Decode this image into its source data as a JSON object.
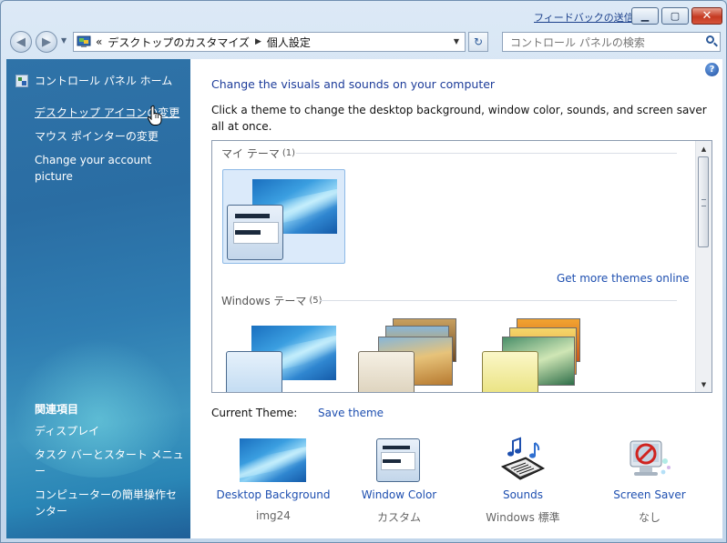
{
  "window": {
    "feedback_link": "フィードバックの送信",
    "controls": {
      "minimize_icon": "minimize-icon",
      "maximize_icon": "maximize-icon",
      "close_icon": "close-icon"
    }
  },
  "nav": {
    "breadcrumb_prefix": "«",
    "breadcrumb": [
      "デスクトップのカスタマイズ",
      "個人設定"
    ],
    "search_placeholder": "コントロール パネルの検索"
  },
  "sidebar": {
    "home": "コントロール パネル ホーム",
    "links": [
      "デスクトップ アイコンの変更",
      "マウス ポインターの変更",
      "Change your account picture"
    ],
    "related_heading": "関連項目",
    "related_links": [
      "ディスプレイ",
      "タスク バーとスタート メニュー",
      "コンピューターの簡単操作センター"
    ]
  },
  "main": {
    "title": "Change the visuals and sounds on your computer",
    "description": "Click a theme to change the desktop background, window color, sounds, and screen saver all at once.",
    "groups": [
      {
        "label": "マイ テーマ",
        "count": "(1)"
      },
      {
        "label": "Windows テーマ",
        "count": "(5)"
      }
    ],
    "get_more_themes": "Get more themes online",
    "current_theme_label": "Current Theme:",
    "save_theme": "Save theme",
    "bottom_items": [
      {
        "label": "Desktop Background",
        "value": "img24"
      },
      {
        "label": "Window Color",
        "value": "カスタム"
      },
      {
        "label": "Sounds",
        "value": "Windows 標準"
      },
      {
        "label": "Screen Saver",
        "value": "なし"
      }
    ]
  },
  "colors": {
    "link": "#1e4fb0",
    "title": "#1e3d9a",
    "sidebar": "#2f73a8",
    "selection": "#dbeafa"
  }
}
